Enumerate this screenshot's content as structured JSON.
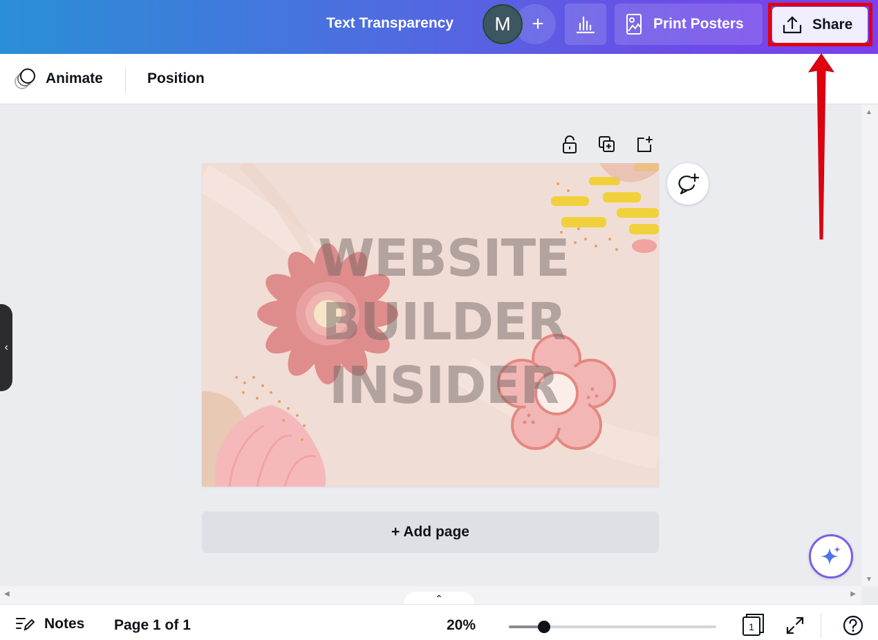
{
  "header": {
    "doc_title": "Text Transparency",
    "avatar_initial": "M",
    "add_collaborator": "+",
    "print_label": "Print Posters",
    "share_label": "Share"
  },
  "toolbar": {
    "animate_label": "Animate",
    "position_label": "Position"
  },
  "canvas": {
    "text_lines": [
      "WEBSITE",
      "BUILDER",
      "INSIDER"
    ],
    "add_page_label": "+ Add page"
  },
  "bottombar": {
    "notes_label": "Notes",
    "page_count": "Page 1 of 1",
    "zoom": "20%",
    "zoom_slider_fraction": 0.17,
    "pages_badge": "1"
  },
  "colors": {
    "highlight": "#e0000f",
    "header_gradient_start": "#2a8fd6",
    "header_gradient_end": "#7b3ff0"
  }
}
